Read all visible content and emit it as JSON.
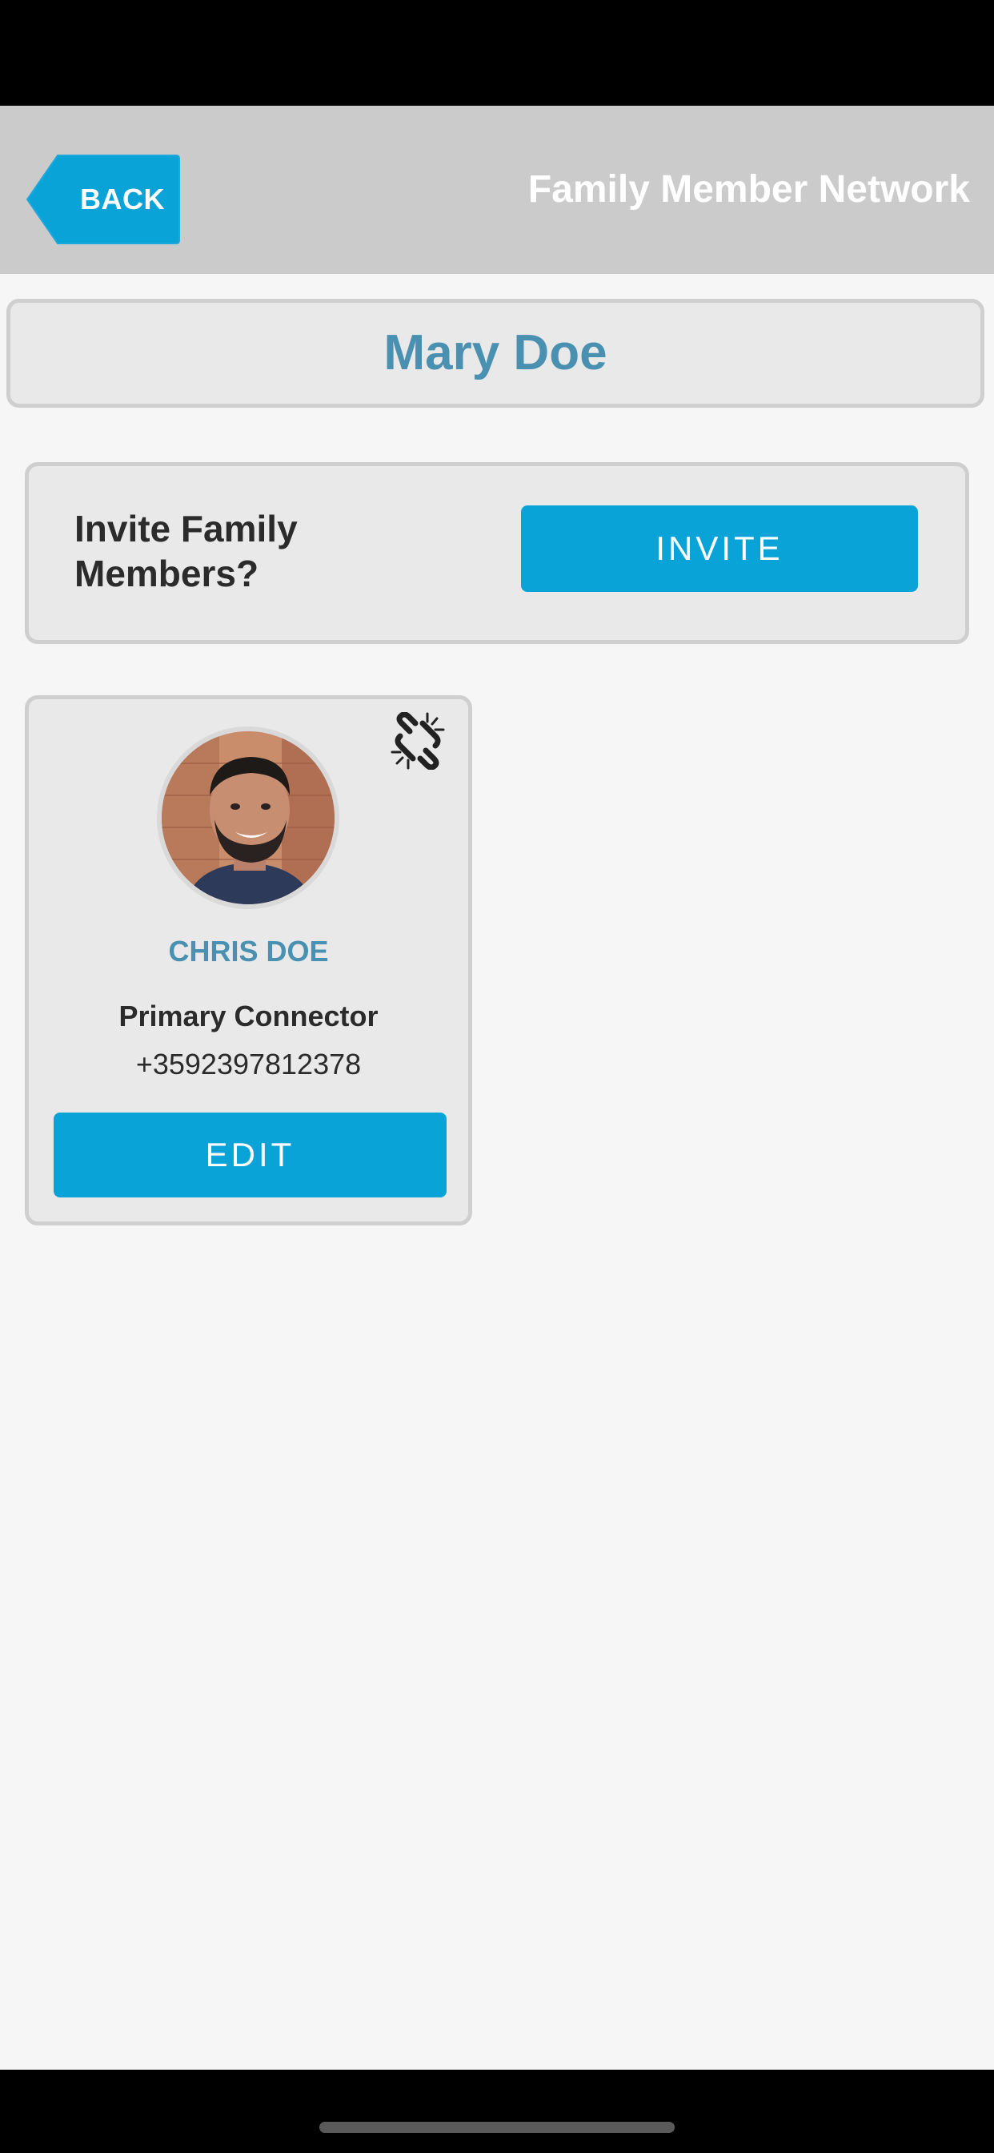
{
  "header": {
    "back_label": "BACK",
    "title": "Family Member Network"
  },
  "profile": {
    "name": "Mary Doe"
  },
  "invite": {
    "prompt": "Invite Family Members?",
    "button_label": "INVITE"
  },
  "members": [
    {
      "name": "CHRIS DOE",
      "role": "Primary Connector",
      "phone": "+3592397812378",
      "edit_label": "EDIT",
      "avatar_icon": "person-photo",
      "action_icon": "unlink-icon"
    }
  ],
  "colors": {
    "accent": "#0aa3d8",
    "name_color": "#4a90b0",
    "header_bg": "#cbcbcb",
    "panel_bg": "#e9e9ea",
    "page_bg": "#f6f6f6"
  }
}
